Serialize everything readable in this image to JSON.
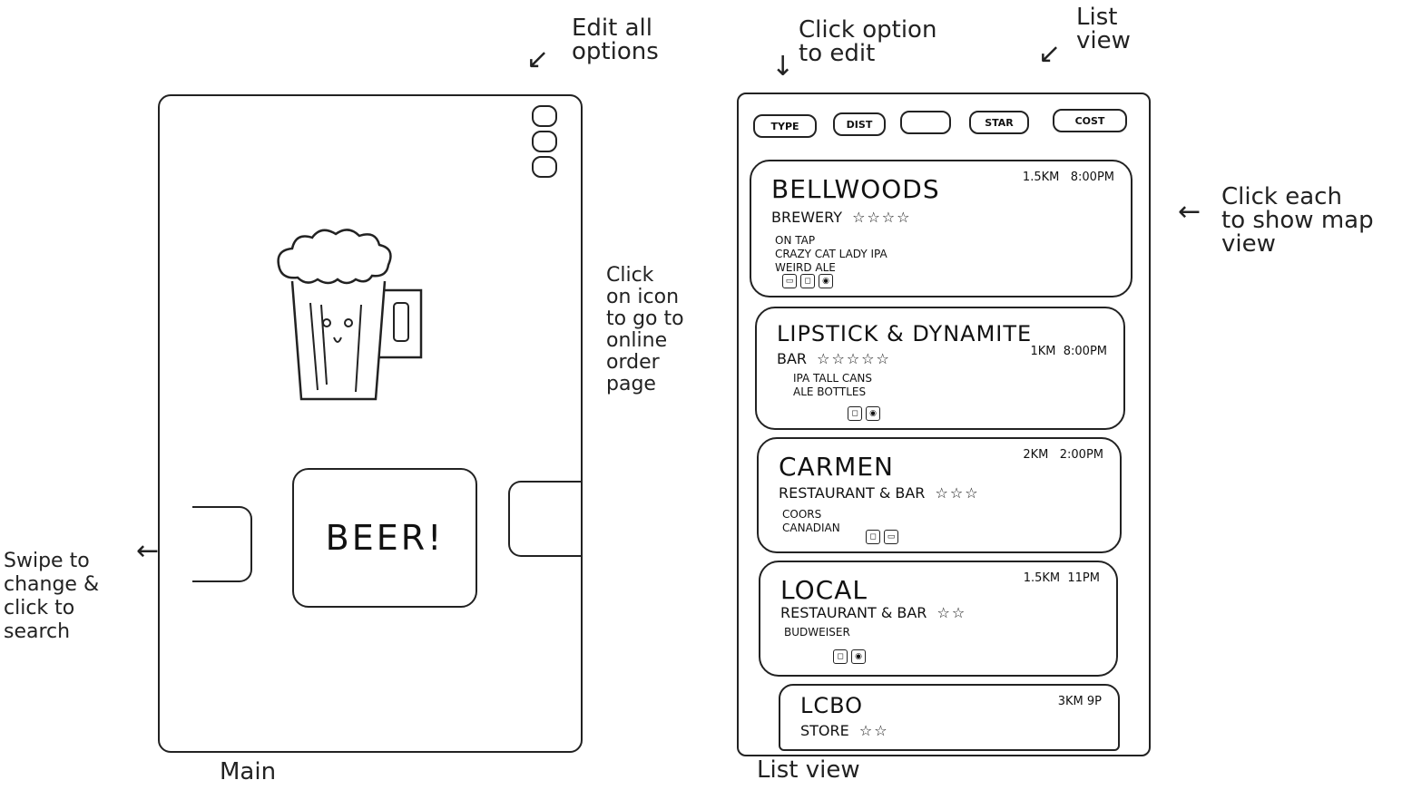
{
  "main_screen": {
    "button_label": "BEER!",
    "caption": "Main"
  },
  "list_screen": {
    "caption": "List view",
    "filters": [
      "TYPE",
      "DIST",
      "",
      "STAR",
      "COST"
    ],
    "venues": [
      {
        "name": "BELLWOODS",
        "type": "BREWERY",
        "stars": "☆☆☆☆",
        "distance": "1.5KM",
        "time": "8:00PM",
        "beers": "ON TAP\nCRAZY CAT LADY IPA\nWEIRD ALE"
      },
      {
        "name": "LIPSTICK & DYNAMITE",
        "type": "BAR",
        "stars": "☆☆☆☆☆",
        "distance": "1KM",
        "time": "8:00PM",
        "beers": "IPA        TALL CANS\nALE        BOTTLES"
      },
      {
        "name": "CARMEN",
        "type": "RESTAURANT & BAR",
        "stars": "☆☆☆",
        "distance": "2KM",
        "time": "2:00PM",
        "beers": "COORS\nCANADIAN"
      },
      {
        "name": "LOCAL",
        "type": "RESTAURANT & BAR",
        "stars": "☆☆",
        "distance": "1.5KM",
        "time": "11PM",
        "beers": "BUDWEISER"
      },
      {
        "name": "LCBO",
        "type": "STORE",
        "stars": "☆☆",
        "distance": "3KM",
        "time": "9P",
        "beers": ""
      }
    ]
  },
  "annotations": {
    "edit_options": "Edit all\noptions",
    "click_option": "Click option\nto edit",
    "list_view": "List\nview",
    "click_each": "Click each\nto show map\nview",
    "click_icon": "Click\non icon\nto go to\nonline\norder\npage",
    "swipe": "Swipe to\nchange &\nclick to\nsearch"
  },
  "colors": {
    "ink": "#222222",
    "paper": "#ffffff"
  },
  "icons": [
    "menu-pills-icon",
    "beer-mug-icon",
    "chevron-left-tab-icon",
    "chevron-right-tab-icon",
    "star-icon",
    "order-icon"
  ]
}
